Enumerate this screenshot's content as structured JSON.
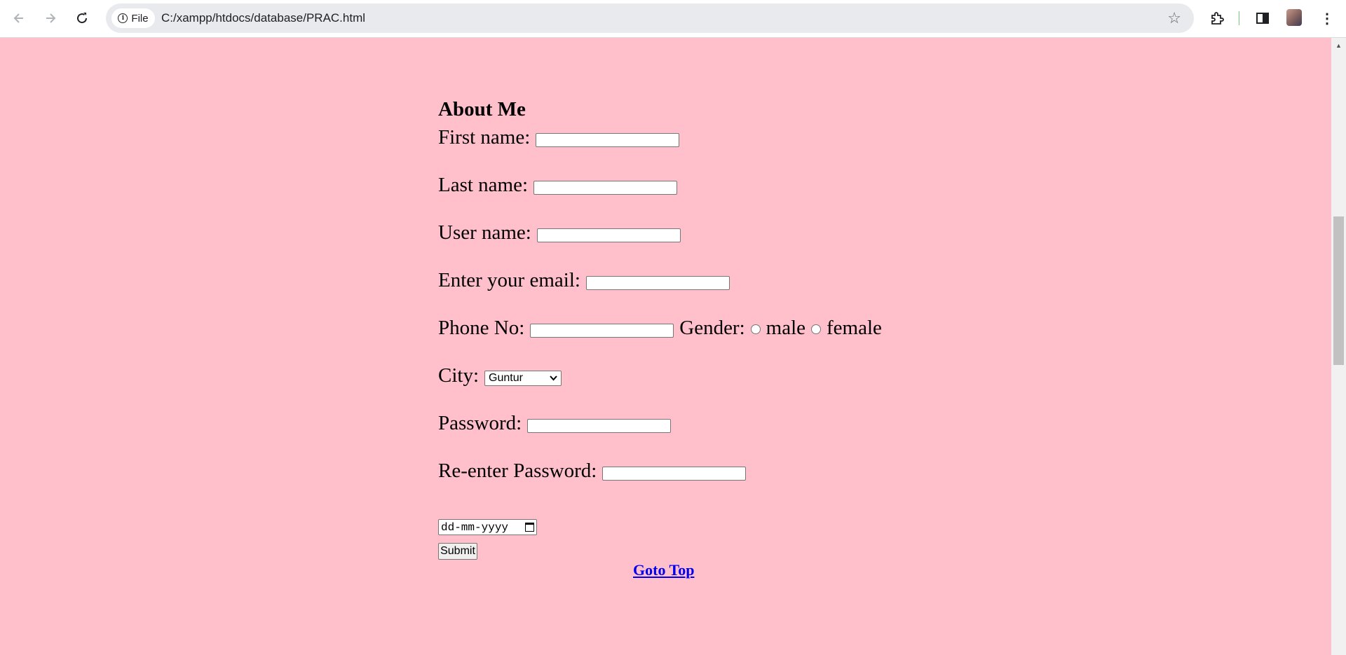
{
  "browser": {
    "chip_label": "File",
    "url": "C:/xampp/htdocs/database/PRAC.html"
  },
  "form": {
    "heading": "About Me",
    "first_name_label": "First name:",
    "last_name_label": "Last name:",
    "user_name_label": "User name:",
    "email_label": "Enter your email:",
    "phone_label": "Phone No:",
    "gender_label": "Gender:",
    "gender_options": [
      "male",
      "female"
    ],
    "city_label": "City:",
    "city_selected": "Guntur",
    "password_label": "Password:",
    "reenter_password_label": "Re-enter Password:",
    "date_placeholder": "dd-mm-yyyy",
    "submit_label": "Submit",
    "goto_top_label": "Goto Top"
  },
  "colors": {
    "page_background": "#ffc0cb",
    "link": "#0000ee"
  }
}
